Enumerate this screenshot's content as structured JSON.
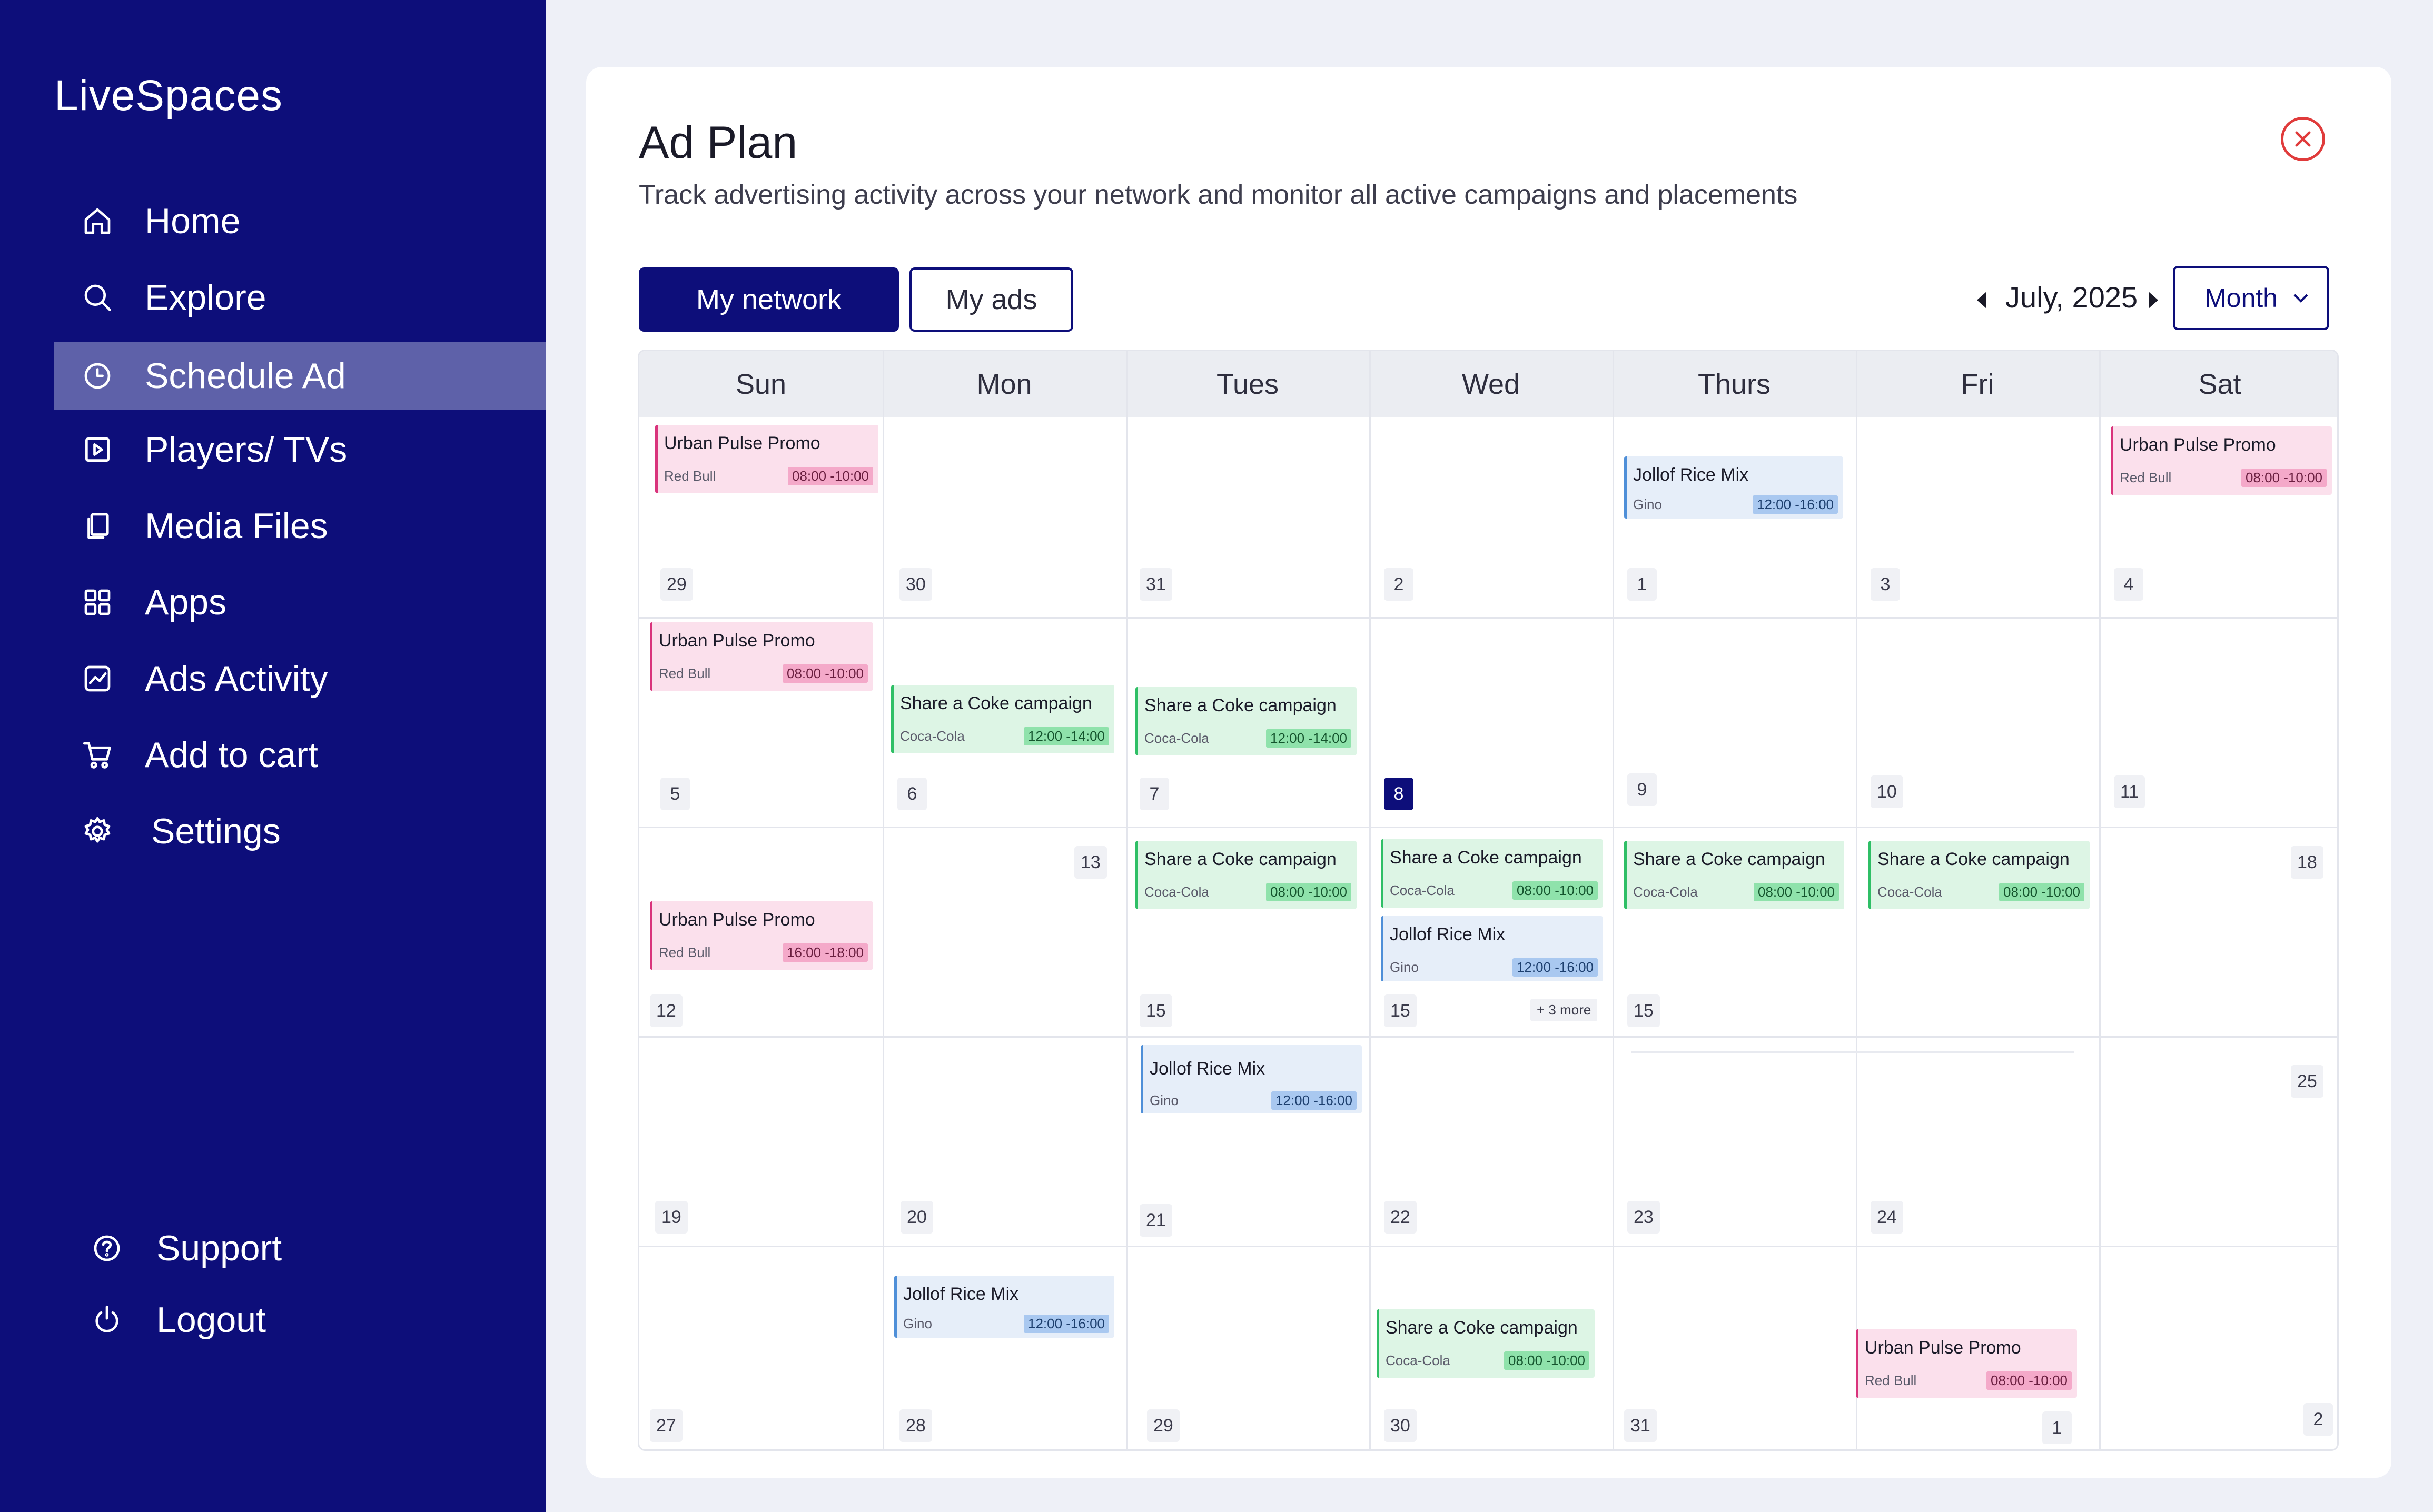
{
  "sidebar": {
    "brand": "LiveSpaces",
    "items": [
      {
        "label": "Home",
        "icon": "home-icon"
      },
      {
        "label": "Explore",
        "icon": "search-icon"
      },
      {
        "label": "Schedule Ad",
        "icon": "clock-icon",
        "active": true
      },
      {
        "label": "Players/ TVs",
        "icon": "play-icon"
      },
      {
        "label": "Media Files",
        "icon": "copy-icon"
      },
      {
        "label": "Apps",
        "icon": "grid-icon"
      },
      {
        "label": "Ads Activity",
        "icon": "activity-icon"
      },
      {
        "label": "Add to cart",
        "icon": "cart-icon"
      },
      {
        "label": "Settings",
        "icon": "gear-icon"
      }
    ],
    "support": "Support",
    "logout": "Logout"
  },
  "header": {
    "title": "Ad Plan",
    "subtitle": "Track advertising activity across your network and monitor  all active campaigns and placements"
  },
  "tabs": {
    "network": "My network",
    "ads": "My ads"
  },
  "month": {
    "label": "July, 2025",
    "view": "Month"
  },
  "calendar": {
    "days": [
      "Sun",
      "Mon",
      "Tues",
      "Wed",
      "Thurs",
      "Fri",
      "Sat"
    ],
    "dates": [
      [
        "29",
        "30",
        "31",
        "2",
        "1",
        "3",
        "4"
      ],
      [
        "5",
        "6",
        "7",
        "8",
        "9",
        "10",
        "11"
      ],
      [
        "12",
        "13",
        "15",
        "15",
        "15",
        "",
        "18"
      ],
      [
        "19",
        "20",
        "21",
        "22",
        "23",
        "24",
        "25"
      ],
      [
        "27",
        "28",
        "29",
        "30",
        "31",
        "1",
        "2"
      ]
    ],
    "more": "+ 3 more",
    "today": "8",
    "events": [
      {
        "title": "Urban Pulse Promo",
        "brand": "Red Bull",
        "time": "08:00 -10:00",
        "color": "pink"
      },
      {
        "title": "Jollof Rice Mix",
        "brand": "Gino",
        "time": "12:00 -16:00",
        "color": "blue"
      },
      {
        "title": "Urban Pulse Promo",
        "brand": "Red Bull",
        "time": "08:00 -10:00",
        "color": "pink"
      },
      {
        "title": "Urban Pulse Promo",
        "brand": "Red Bull",
        "time": "08:00 -10:00",
        "color": "pink"
      },
      {
        "title": "Share a Coke campaign",
        "brand": "Coca-Cola",
        "time": "12:00 -14:00",
        "color": "green"
      },
      {
        "title": "Share a Coke campaign",
        "brand": "Coca-Cola",
        "time": "12:00 -14:00",
        "color": "green"
      },
      {
        "title": "Urban Pulse Promo",
        "brand": "Red Bull",
        "time": "16:00 -18:00",
        "color": "pink"
      },
      {
        "title": "Share a Coke campaign",
        "brand": "Coca-Cola",
        "time": "08:00 -10:00",
        "color": "green"
      },
      {
        "title": "Share a Coke campaign",
        "brand": "Coca-Cola",
        "time": "08:00 -10:00",
        "color": "green"
      },
      {
        "title": "Jollof Rice Mix",
        "brand": "Gino",
        "time": "12:00 -16:00",
        "color": "blue"
      },
      {
        "title": "Share a Coke campaign",
        "brand": "Coca-Cola",
        "time": "08:00 -10:00",
        "color": "green"
      },
      {
        "title": "Share a Coke campaign",
        "brand": "Coca-Cola",
        "time": "08:00 -10:00",
        "color": "green"
      },
      {
        "title": "Jollof Rice Mix",
        "brand": "Gino",
        "time": "12:00 -16:00",
        "color": "blue"
      },
      {
        "title": "Jollof Rice Mix",
        "brand": "Gino",
        "time": "12:00 -16:00",
        "color": "blue"
      },
      {
        "title": "Share a Coke campaign",
        "brand": "Coca-Cola",
        "time": "08:00 -10:00",
        "color": "green"
      },
      {
        "title": "Urban Pulse Promo",
        "brand": "Red Bull",
        "time": "08:00 -10:00",
        "color": "pink"
      }
    ]
  },
  "colors": {
    "sidebar": "#0D0E7A",
    "active_item": "#5E61A9",
    "close": "#E03B3B",
    "pink": "#D9347C",
    "green": "#2FBF66",
    "blue": "#4F8FD8"
  }
}
